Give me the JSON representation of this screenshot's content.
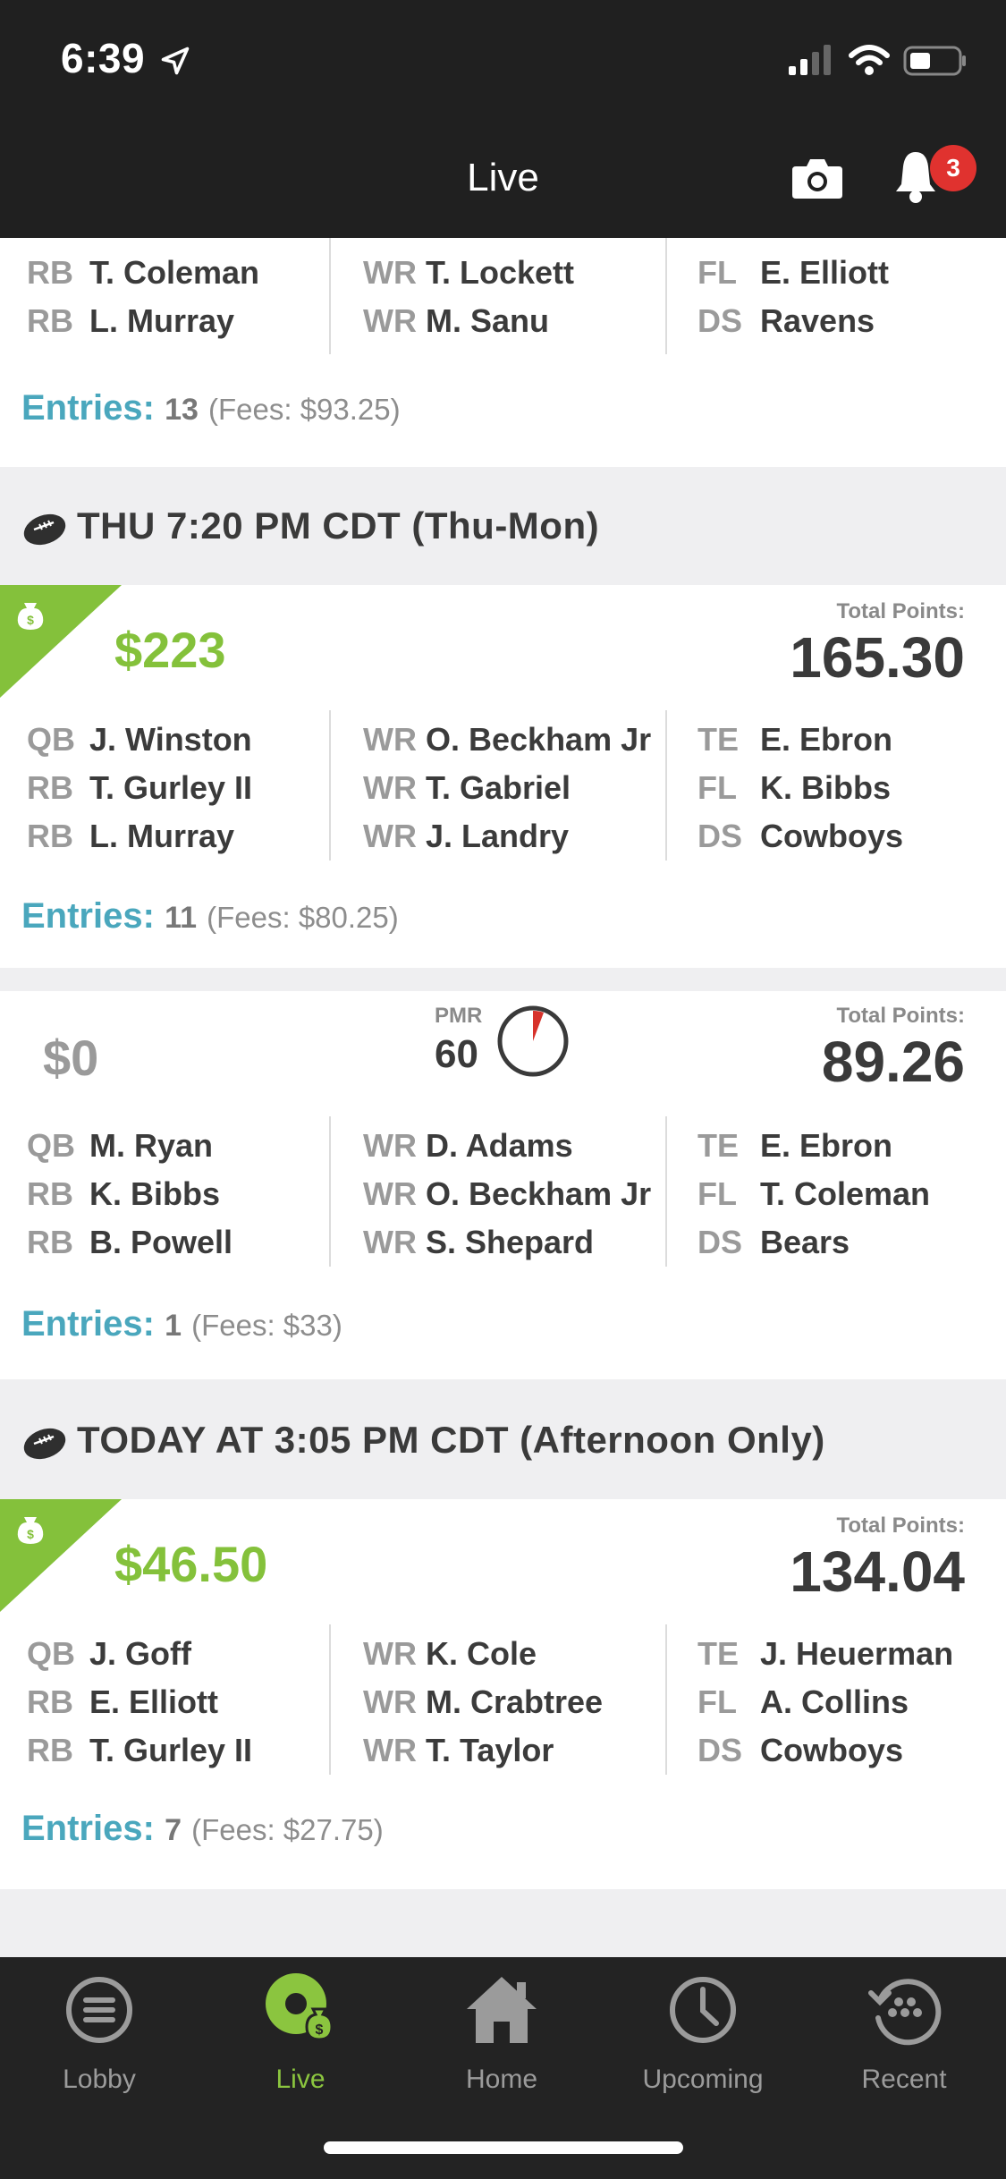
{
  "status_bar": {
    "time": "6:39"
  },
  "header": {
    "title": "Live",
    "notification_count": "3"
  },
  "top_partial": {
    "rows": [
      [
        {
          "pos": "RB",
          "name": "T. Coleman"
        },
        {
          "pos": "WR",
          "name": "T. Lockett"
        },
        {
          "pos": "FL",
          "name": "E. Elliott"
        }
      ],
      [
        {
          "pos": "RB",
          "name": "L. Murray"
        },
        {
          "pos": "WR",
          "name": "M. Sanu"
        },
        {
          "pos": "DS",
          "name": "Ravens"
        }
      ]
    ],
    "entries_label": "Entries:",
    "entries_count": "13",
    "fees": "(Fees: $93.25)"
  },
  "sections": [
    {
      "header": "THU 7:20 PM CDT  (Thu-Mon)",
      "cards": [
        {
          "winnings": "$223",
          "total_points_label": "Total Points:",
          "total_points": "165.30",
          "rows": [
            [
              {
                "pos": "QB",
                "name": "J. Winston"
              },
              {
                "pos": "WR",
                "name": "O. Beckham Jr"
              },
              {
                "pos": "TE",
                "name": "E. Ebron"
              }
            ],
            [
              {
                "pos": "RB",
                "name": "T. Gurley II"
              },
              {
                "pos": "WR",
                "name": "T. Gabriel"
              },
              {
                "pos": "FL",
                "name": "K. Bibbs"
              }
            ],
            [
              {
                "pos": "RB",
                "name": "L. Murray"
              },
              {
                "pos": "WR",
                "name": "J. Landry"
              },
              {
                "pos": "DS",
                "name": "Cowboys"
              }
            ]
          ],
          "entries_label": "Entries:",
          "entries_count": "11",
          "fees": "(Fees: $80.25)"
        },
        {
          "winnings": "$0",
          "pmr_label": "PMR",
          "pmr_value": "60",
          "total_points_label": "Total Points:",
          "total_points": "89.26",
          "rows": [
            [
              {
                "pos": "QB",
                "name": "M. Ryan"
              },
              {
                "pos": "WR",
                "name": "D. Adams"
              },
              {
                "pos": "TE",
                "name": "E. Ebron"
              }
            ],
            [
              {
                "pos": "RB",
                "name": "K. Bibbs"
              },
              {
                "pos": "WR",
                "name": "O. Beckham Jr"
              },
              {
                "pos": "FL",
                "name": "T. Coleman"
              }
            ],
            [
              {
                "pos": "RB",
                "name": "B. Powell"
              },
              {
                "pos": "WR",
                "name": "S. Shepard"
              },
              {
                "pos": "DS",
                "name": "Bears"
              }
            ]
          ],
          "entries_label": "Entries:",
          "entries_count": "1",
          "fees": "(Fees: $33)"
        }
      ]
    },
    {
      "header": "TODAY AT 3:05 PM CDT  (Afternoon Only)",
      "cards": [
        {
          "winnings": "$46.50",
          "total_points_label": "Total Points:",
          "total_points": "134.04",
          "rows": [
            [
              {
                "pos": "QB",
                "name": "J. Goff"
              },
              {
                "pos": "WR",
                "name": "K. Cole"
              },
              {
                "pos": "TE",
                "name": "J. Heuerman"
              }
            ],
            [
              {
                "pos": "RB",
                "name": "E. Elliott"
              },
              {
                "pos": "WR",
                "name": "M. Crabtree"
              },
              {
                "pos": "FL",
                "name": "A. Collins"
              }
            ],
            [
              {
                "pos": "RB",
                "name": "T. Gurley II"
              },
              {
                "pos": "WR",
                "name": "T. Taylor"
              },
              {
                "pos": "DS",
                "name": "Cowboys"
              }
            ]
          ],
          "entries_label": "Entries:",
          "entries_count": "7",
          "fees": "(Fees: $27.75)"
        }
      ]
    }
  ],
  "tabs": [
    {
      "label": "Lobby",
      "icon": "menu-circle-icon",
      "active": false
    },
    {
      "label": "Live",
      "icon": "live-money-icon",
      "active": true
    },
    {
      "label": "Home",
      "icon": "home-icon",
      "active": false
    },
    {
      "label": "Upcoming",
      "icon": "clock-icon",
      "active": false
    },
    {
      "label": "Recent",
      "icon": "history-icon",
      "active": false
    }
  ],
  "colors": {
    "accent_green": "#84c13b",
    "entries_blue": "#4aa7bd",
    "badge_red": "#e0322f",
    "bar_dark": "#202020"
  }
}
